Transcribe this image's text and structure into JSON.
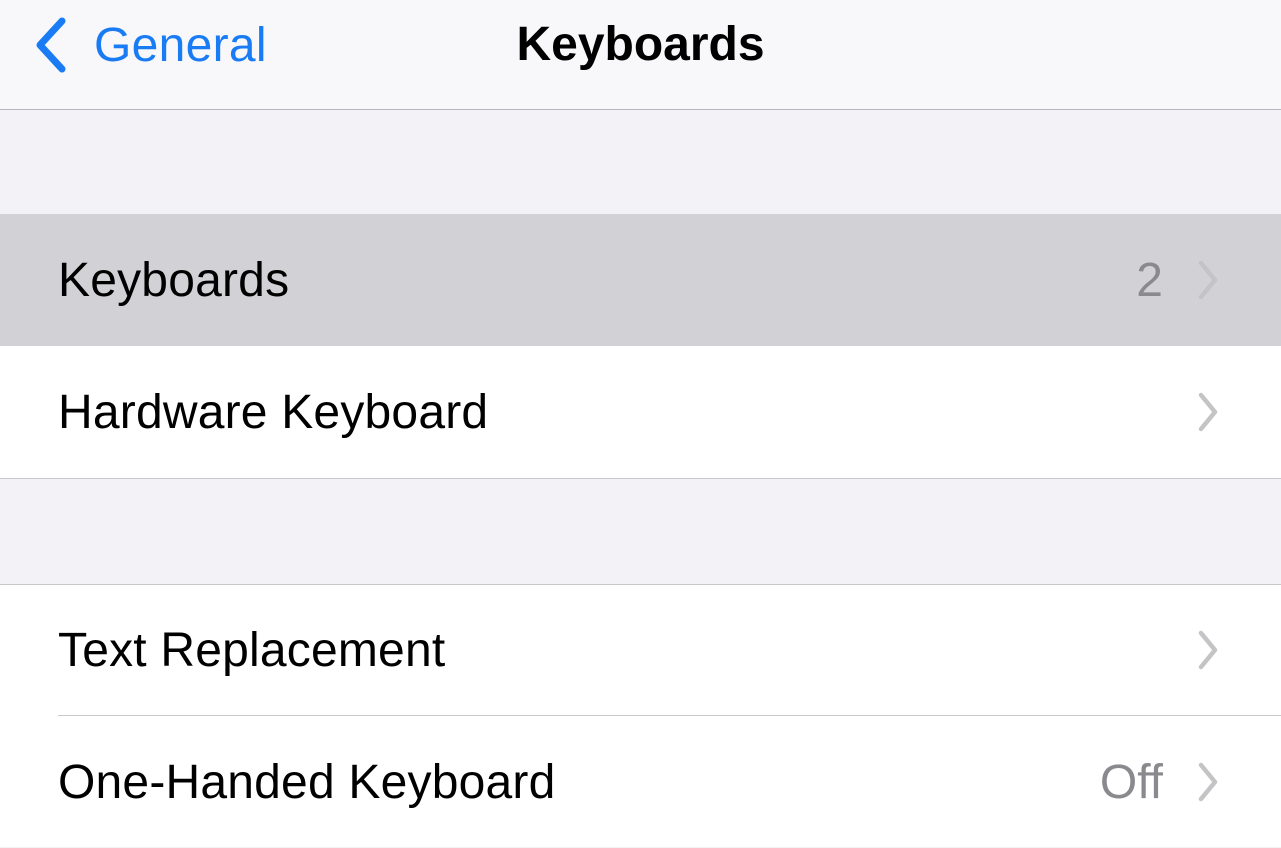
{
  "navbar": {
    "back_label": "General",
    "title": "Keyboards"
  },
  "groups": [
    {
      "rows": [
        {
          "label": "Keyboards",
          "value": "2",
          "highlighted": true
        },
        {
          "label": "Hardware Keyboard",
          "value": ""
        }
      ]
    },
    {
      "rows": [
        {
          "label": "Text Replacement",
          "value": ""
        },
        {
          "label": "One-Handed Keyboard",
          "value": "Off"
        }
      ]
    }
  ],
  "colors": {
    "accent": "#1a7cf5",
    "background": "#f2f2f7",
    "highlight": "#d1d1d6",
    "secondary_text": "#8a8a8e",
    "chevron": "#c4c4c7"
  },
  "icons": {
    "back": "chevron-left-icon",
    "disclosure": "chevron-right-icon"
  }
}
